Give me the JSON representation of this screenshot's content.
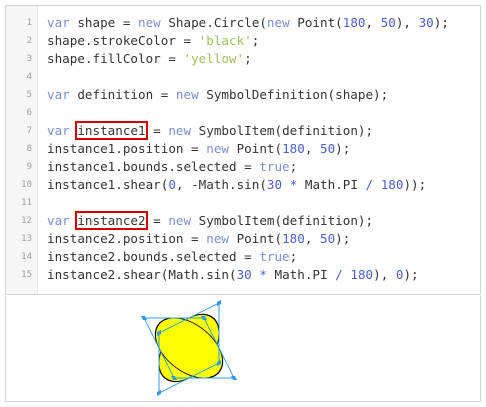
{
  "lines": [
    {
      "n": "1",
      "parts": [
        {
          "t": "var",
          "c": "kw"
        },
        {
          "t": " shape = "
        },
        {
          "t": "new",
          "c": "kw"
        },
        {
          "t": " Shape.Circle("
        },
        {
          "t": "new",
          "c": "kw"
        },
        {
          "t": " Point("
        },
        {
          "t": "180",
          "c": "num"
        },
        {
          "t": ", "
        },
        {
          "t": "50",
          "c": "num"
        },
        {
          "t": "), "
        },
        {
          "t": "30",
          "c": "num"
        },
        {
          "t": ");"
        }
      ]
    },
    {
      "n": "2",
      "parts": [
        {
          "t": "shape.strokeColor = "
        },
        {
          "t": "'black'",
          "c": "str"
        },
        {
          "t": ";"
        }
      ]
    },
    {
      "n": "3",
      "parts": [
        {
          "t": "shape.fillColor = "
        },
        {
          "t": "'yellow'",
          "c": "str"
        },
        {
          "t": ";"
        }
      ]
    },
    {
      "n": "4",
      "parts": []
    },
    {
      "n": "5",
      "parts": [
        {
          "t": "var",
          "c": "kw"
        },
        {
          "t": " definition = "
        },
        {
          "t": "new",
          "c": "kw"
        },
        {
          "t": " SymbolDefinition(shape);"
        }
      ]
    },
    {
      "n": "6",
      "parts": []
    },
    {
      "n": "7",
      "parts": [
        {
          "t": "var",
          "c": "kw"
        },
        {
          "t": " "
        },
        {
          "t": "instance1",
          "h": true
        },
        {
          "t": " = "
        },
        {
          "t": "new",
          "c": "kw"
        },
        {
          "t": " SymbolItem(definition);"
        }
      ]
    },
    {
      "n": "8",
      "parts": [
        {
          "t": "instance1.position = "
        },
        {
          "t": "new",
          "c": "kw"
        },
        {
          "t": " Point("
        },
        {
          "t": "180",
          "c": "num"
        },
        {
          "t": ", "
        },
        {
          "t": "50",
          "c": "num"
        },
        {
          "t": ");"
        }
      ]
    },
    {
      "n": "9",
      "parts": [
        {
          "t": "instance1.bounds.selected = "
        },
        {
          "t": "true",
          "c": "kw"
        },
        {
          "t": ";"
        }
      ]
    },
    {
      "n": "10",
      "parts": [
        {
          "t": "instance1.shear("
        },
        {
          "t": "0",
          "c": "num"
        },
        {
          "t": ", -Math.sin("
        },
        {
          "t": "30",
          "c": "num"
        },
        {
          "t": " "
        },
        {
          "t": "*",
          "c": "op"
        },
        {
          "t": " Math.PI "
        },
        {
          "t": "/",
          "c": "op"
        },
        {
          "t": " "
        },
        {
          "t": "180",
          "c": "num"
        },
        {
          "t": "));"
        }
      ]
    },
    {
      "n": "11",
      "parts": []
    },
    {
      "n": "12",
      "parts": [
        {
          "t": "var",
          "c": "kw"
        },
        {
          "t": " "
        },
        {
          "t": "instance2",
          "h": true
        },
        {
          "t": " = "
        },
        {
          "t": "new",
          "c": "kw"
        },
        {
          "t": " SymbolItem(definition);"
        }
      ]
    },
    {
      "n": "13",
      "parts": [
        {
          "t": "instance2.position = "
        },
        {
          "t": "new",
          "c": "kw"
        },
        {
          "t": " Point("
        },
        {
          "t": "180",
          "c": "num"
        },
        {
          "t": ", "
        },
        {
          "t": "50",
          "c": "num"
        },
        {
          "t": ");"
        }
      ]
    },
    {
      "n": "14",
      "parts": [
        {
          "t": "instance2.bounds.selected = "
        },
        {
          "t": "true",
          "c": "kw"
        },
        {
          "t": ";"
        }
      ]
    },
    {
      "n": "15",
      "parts": [
        {
          "t": "instance2.shear(Math.sin("
        },
        {
          "t": "30",
          "c": "num"
        },
        {
          "t": " "
        },
        {
          "t": "*",
          "c": "op"
        },
        {
          "t": " Math.PI "
        },
        {
          "t": "/",
          "c": "op"
        },
        {
          "t": " "
        },
        {
          "t": "180",
          "c": "num"
        },
        {
          "t": "), "
        },
        {
          "t": "0",
          "c": "num"
        },
        {
          "t": ");"
        }
      ]
    }
  ],
  "colors": {
    "keyword": "#7a8fd0",
    "number": "#4a5fd0",
    "string": "#a0c060",
    "highlight": "#d40000",
    "shape_fill": "#ffff00",
    "shape_stroke": "#000000",
    "selection": "#2f9be0"
  }
}
